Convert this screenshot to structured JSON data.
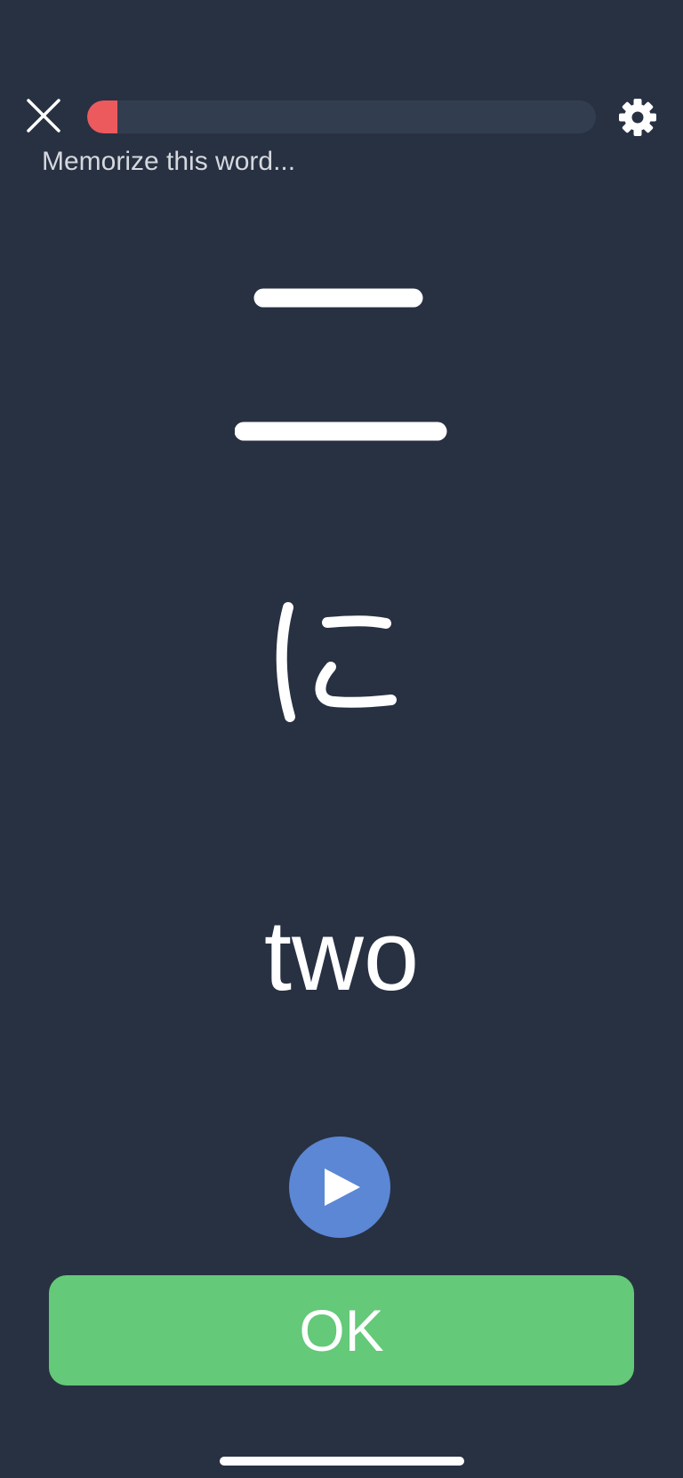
{
  "header": {
    "close_icon": "close-icon",
    "settings_icon": "gear-icon",
    "progress": 0.06
  },
  "prompt": "Memorize this word...",
  "word": {
    "kanji": "二",
    "reading": "に",
    "meaning": "two"
  },
  "audio": {
    "icon": "play-icon"
  },
  "actions": {
    "ok_label": "OK"
  },
  "colors": {
    "background": "#283142",
    "progress_track": "#323e4f",
    "progress_fill": "#ec5a5e",
    "play_button": "#5b87d5",
    "ok_button": "#64c978"
  }
}
